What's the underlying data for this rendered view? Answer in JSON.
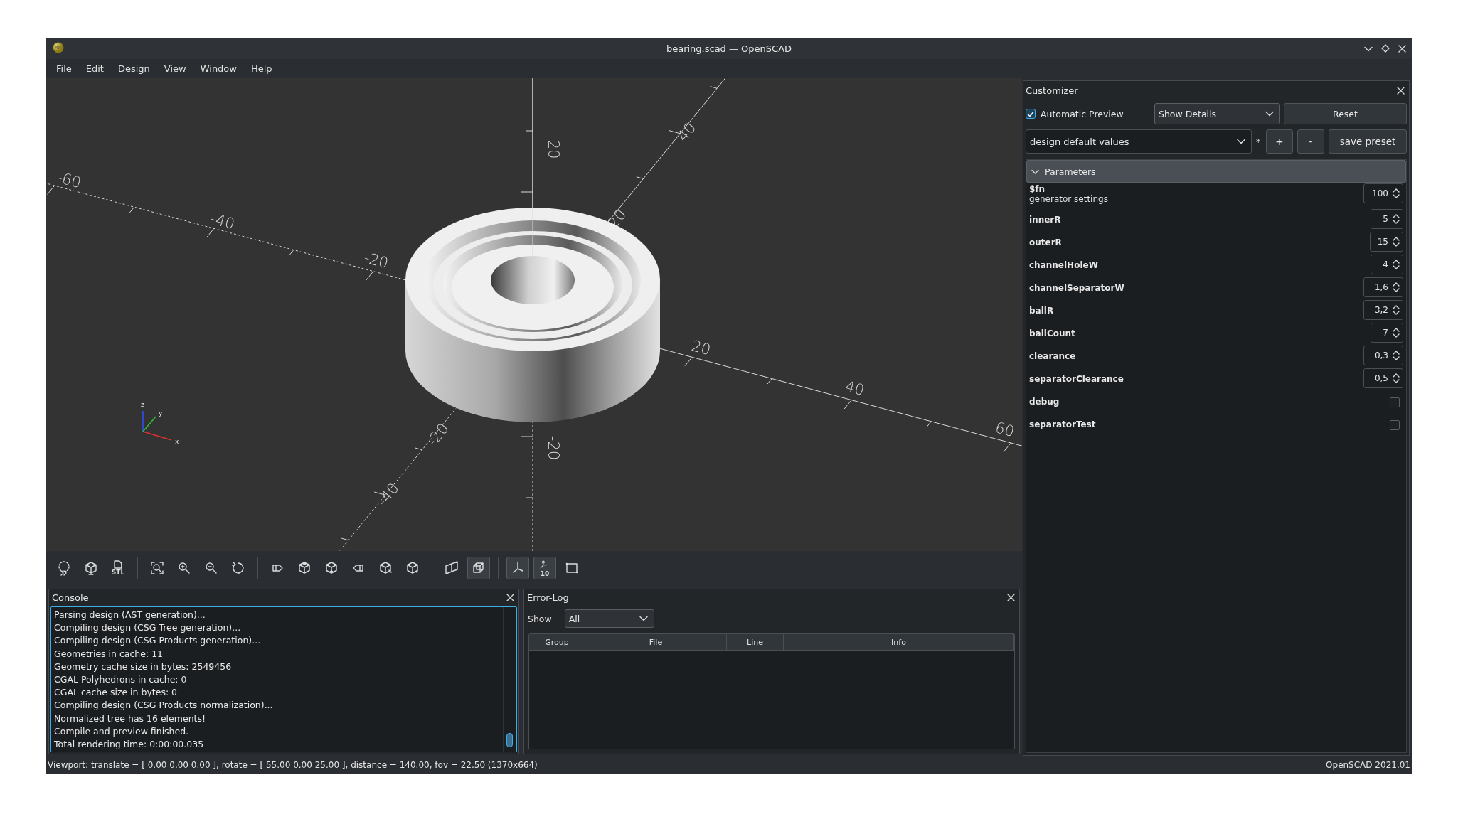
{
  "window": {
    "title": "bearing.scad — OpenSCAD"
  },
  "menu": [
    "File",
    "Edit",
    "Design",
    "View",
    "Window",
    "Help"
  ],
  "viewport": {
    "axis_labels": [
      {
        "kind": "x",
        "text": "-60"
      },
      {
        "kind": "x",
        "text": "-40"
      },
      {
        "kind": "x",
        "text": "-20"
      },
      {
        "kind": "x",
        "text": "20"
      },
      {
        "kind": "x",
        "text": "40"
      },
      {
        "kind": "x",
        "text": "60"
      },
      {
        "kind": "z",
        "text": "20"
      },
      {
        "kind": "z",
        "text": "-20"
      },
      {
        "kind": "y",
        "text": "40"
      },
      {
        "kind": "y",
        "text": "20"
      },
      {
        "kind": "y",
        "text": "-20"
      },
      {
        "kind": "y",
        "text": "-40"
      }
    ],
    "gizmo_letters": [
      {
        "kind": "z",
        "text": "z"
      },
      {
        "kind": "y",
        "text": "y"
      },
      {
        "kind": "x",
        "text": "x"
      }
    ]
  },
  "toolbar": [
    {
      "kind": "preview"
    },
    {
      "kind": "render"
    },
    {
      "kind": "export",
      "label": "STL"
    },
    {
      "kind": "separator"
    },
    {
      "kind": "view_all"
    },
    {
      "kind": "zoom_in"
    },
    {
      "kind": "zoom_out"
    },
    {
      "kind": "reset_view"
    },
    {
      "kind": "separator"
    },
    {
      "kind": "right"
    },
    {
      "kind": "top"
    },
    {
      "kind": "bottom"
    },
    {
      "kind": "left"
    },
    {
      "kind": "front"
    },
    {
      "kind": "back"
    },
    {
      "kind": "separator"
    },
    {
      "kind": "perspective",
      "on": false
    },
    {
      "kind": "orthogonal",
      "on": true
    },
    {
      "kind": "separator"
    },
    {
      "kind": "axes",
      "on": true
    },
    {
      "kind": "scale_markers",
      "on": true,
      "label": "10"
    },
    {
      "kind": "edges",
      "on": false
    }
  ],
  "console": {
    "title": "Console",
    "lines": [
      "Parsing design (AST generation)...",
      "Compiling design (CSG Tree generation)...",
      "Compiling design (CSG Products generation)...",
      "Geometries in cache: 11",
      "Geometry cache size in bytes: 2549456",
      "CGAL Polyhedrons in cache: 0",
      "CGAL cache size in bytes: 0",
      "Compiling design (CSG Products normalization)...",
      "Normalized tree has 16 elements!",
      "Compile and preview finished.",
      "Total rendering time: 0:00:00.035"
    ]
  },
  "error_log": {
    "title": "Error-Log",
    "show_label": "Show",
    "show_value": "All",
    "columns": [
      "Group",
      "File",
      "Line",
      "Info"
    ]
  },
  "customizer": {
    "title": "Customizer",
    "auto_preview": {
      "label": "Automatic Preview",
      "checked": true
    },
    "detail_mode": "Show Details",
    "reset": "Reset",
    "preset": "design default values",
    "modified_mark": "*",
    "add": "+",
    "remove": "-",
    "save": "save preset",
    "parameters": {
      "title": "Parameters",
      "expanded": true,
      "items": [
        {
          "kind": "number",
          "name": "$fn",
          "description": "generator settings",
          "value": "100"
        },
        {
          "kind": "number",
          "name": "innerR",
          "value": "5"
        },
        {
          "kind": "number",
          "name": "outerR",
          "value": "15"
        },
        {
          "kind": "number",
          "name": "channelHoleW",
          "value": "4"
        },
        {
          "kind": "number",
          "name": "channelSeparatorW",
          "value": "1,6"
        },
        {
          "kind": "number",
          "name": "ballR",
          "value": "3,2"
        },
        {
          "kind": "number",
          "name": "ballCount",
          "value": "7"
        },
        {
          "kind": "number",
          "name": "clearance",
          "value": "0,3"
        },
        {
          "kind": "number",
          "name": "separatorClearance",
          "value": "0,5"
        },
        {
          "kind": "checkbox",
          "name": "debug",
          "checked": false
        },
        {
          "kind": "checkbox",
          "name": "separatorTest",
          "checked": false
        }
      ]
    }
  },
  "status_bar": {
    "viewport_info": "Viewport: translate = [ 0.00 0.00 0.00 ], rotate = [ 55.00 0.00 25.00 ], distance = 140.00, fov = 22.50 (1370x664)",
    "version": "OpenSCAD 2021.01"
  }
}
